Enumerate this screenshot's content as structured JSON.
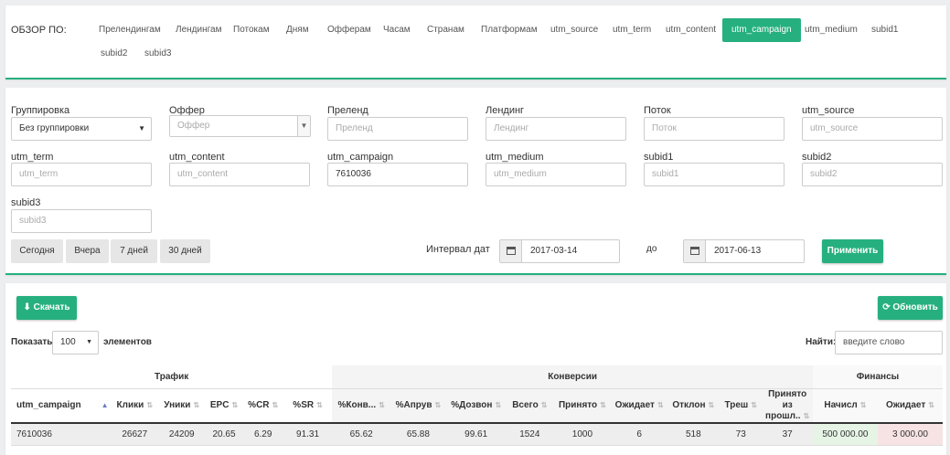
{
  "overview": {
    "label": "ОБЗОР ПО:",
    "tabs": [
      "Прелендингам",
      "Лендингам",
      "Потокам",
      "Дням",
      "Офферам",
      "Часам",
      "Странам",
      "Платформам",
      "utm_source",
      "utm_term",
      "utm_content",
      "utm_campaign",
      "utm_medium",
      "subid1",
      "subid2",
      "subid3"
    ],
    "active_tab": "utm_campaign"
  },
  "filters": {
    "grouping": {
      "label": "Группировка",
      "value": "Без группировки"
    },
    "offer": {
      "label": "Оффер",
      "placeholder": "Оффер"
    },
    "prelend": {
      "label": "Преленд",
      "placeholder": "Преленд"
    },
    "landing": {
      "label": "Лендинг",
      "placeholder": "Лендинг"
    },
    "stream": {
      "label": "Поток",
      "placeholder": "Поток"
    },
    "utm_source": {
      "label": "utm_source",
      "placeholder": "utm_source"
    },
    "utm_term": {
      "label": "utm_term",
      "placeholder": "utm_term"
    },
    "utm_content": {
      "label": "utm_content",
      "placeholder": "utm_content"
    },
    "utm_campaign": {
      "label": "utm_campaign",
      "value": "7610036"
    },
    "utm_medium": {
      "label": "utm_medium",
      "placeholder": "utm_medium"
    },
    "subid1": {
      "label": "subid1",
      "placeholder": "subid1"
    },
    "subid2": {
      "label": "subid2",
      "placeholder": "subid2"
    },
    "subid3": {
      "label": "subid3",
      "placeholder": "subid3"
    },
    "quick": {
      "today": "Сегодня",
      "yesterday": "Вчера",
      "week": "7 дней",
      "month": "30 дней"
    },
    "date_interval_label": "Интервал дат",
    "date_from": "2017-03-14",
    "to_label": "до",
    "date_to": "2017-06-13",
    "apply_label": "Применить"
  },
  "table_controls": {
    "download_label": "Скачать",
    "refresh_label": "Обновить",
    "show_label": "Показать",
    "page_size": "100",
    "elements_label": "элементов",
    "search_label": "Найти:",
    "search_placeholder": "введите слово"
  },
  "table": {
    "groups": {
      "traffic": "Трафик",
      "conversions": "Конверсии",
      "finance": "Финансы"
    },
    "columns": [
      "utm_campaign",
      "Клики",
      "Уники",
      "EPC",
      "%CR",
      "%SR",
      "%Конв...",
      "%Апрув",
      "%Дозвон",
      "Всего",
      "Принято",
      "Ожидает",
      "Отклон",
      "Треш",
      "Принято из прошл..",
      "Начисл",
      "Ожидает"
    ],
    "rows": [
      [
        "7610036",
        "26627",
        "24209",
        "20.65",
        "6.29",
        "91.31",
        "65.62",
        "65.88",
        "99.61",
        "1524",
        "1000",
        "6",
        "518",
        "73",
        "37",
        "500 000.00",
        "3 000.00"
      ]
    ]
  }
}
